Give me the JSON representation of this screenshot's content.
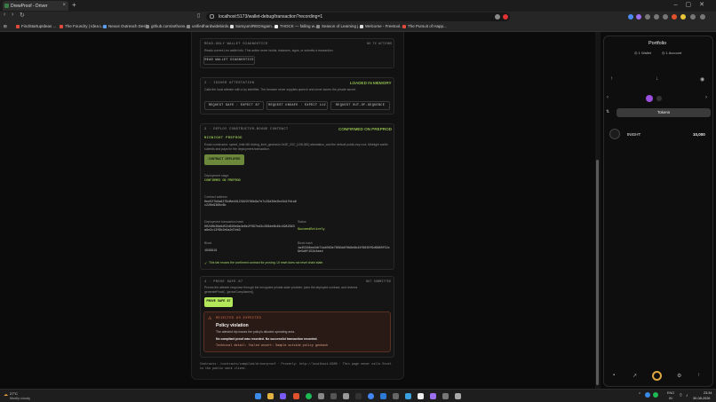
{
  "browser": {
    "tab_title": "DrewProof - Driver",
    "url": "localhost:5173/wallet-debug/transaction?recording=1",
    "bookmarks": [
      "FindStartupIdeas ...",
      "The Foundry | Idea L...",
      "Nexus Outreach Desk",
      "github.com/arthons...",
      "unifiedhardwidebirds...",
      "Samyum/REDIsgam...",
      "THOCK — falling w...",
      "Season of Learning j...",
      "Welcome - Freetool...",
      "The Pursuit of Happ..."
    ]
  },
  "diag": {
    "heading": "READ-ONLY WALLET DIAGNOSTICS",
    "status": "NO TX ACTIONS",
    "desc": "Reads current Leo wallet info. This action never builds, balances, signs, or submits a transaction.",
    "button": "READ WALLET DIAGNOSTICS"
  },
  "attest": {
    "heading": "2 · ISSUER ATTESTATION",
    "status": "LOADED IN MEMORY",
    "desc": "Calls the local attester with a try identifier. The browser never supplies speech and never stores the private secret.",
    "buttons": [
      "REQUEST SAFE · EXPECT 87",
      "REQUEST UNSAFE · EXPECT 112",
      "REQUEST OUT-OF-SEQUENCE"
    ]
  },
  "deploy": {
    "heading": "3 · DEPLOY CONSTRUCTOR-BOUND CONTRACT",
    "status": "CONFIRMED ON PREPROD",
    "network": "MIDNIGHT PREPROD",
    "desc": "Exact constructor: speed_limit=88 driving_limit_geohash=0x3E_002_(108,360) attestation_and the default public-key root. Midnight wallet submits and pays for the deployment transaction.",
    "button": "CONTRACT DEPLOYED",
    "stage_label": "Deployment stage",
    "stage_value": "CONFIRMED ON PREPROD",
    "address_label": "Contract address",
    "address_value": "0ee527b9a6278d8e48123923f69b9a7e7c29d38e2be3d1fb1a6c220e9360c6b",
    "tx_label": "Deployment transaction hash",
    "tx_value": "00240b36a9d52d628e9a4e6e2f097ed3c288de6b49c4982993a9e2c13f9b2e9a2d7eb3",
    "status_label": "Status",
    "status_value": "SucceedEntirely",
    "block_label": "Block",
    "block_value": "1939919",
    "blockhash_label": "Block hash",
    "blockhash_value": "1a45346ea4db71a4063e7809ddf0b6e9b44f9630f9d6680f52c9e5d6f152d4ead",
    "note": "This tab reuses the confirmed contract for proving. UI reset does not reset chain state."
  },
  "prove": {
    "heading": "4 · PROVE SAFE 87",
    "status": "NOT SUBMITTED",
    "desc": "Proves the attester response through the encrypted private-state provider: joins the deployed contract, and reviews generateProof(...)proveCompliance().",
    "button": "PROVE SAFE 87",
    "error_label": "REJECTED AS EXPECTED",
    "error_title": "Policy violation",
    "error_line1": "The attested trip leaves the policy's allowed operating area.",
    "error_line2": "No compliant proof was recorded. No successful transaction recorded.",
    "error_detail": "Technical detail: failed assert: Sample outside policy geohash"
  },
  "footer": "Contracts: /contracts/compiled/driverproof · Proverly: http://localhost:6300 · This page never calls Excel to the public mock client.",
  "wallet": {
    "title": "Portfolio",
    "wallets": "1 Wallet",
    "accounts": "1 Account",
    "tab": "Tokens",
    "token_name": "tNIGHT",
    "token_amount": "10,000"
  },
  "taskbar": {
    "temp": "27°C",
    "weather": "Mostly cloudy",
    "lang1": "ENG",
    "lang2": "IN",
    "time": "23:34",
    "date": "30-08-2026"
  }
}
